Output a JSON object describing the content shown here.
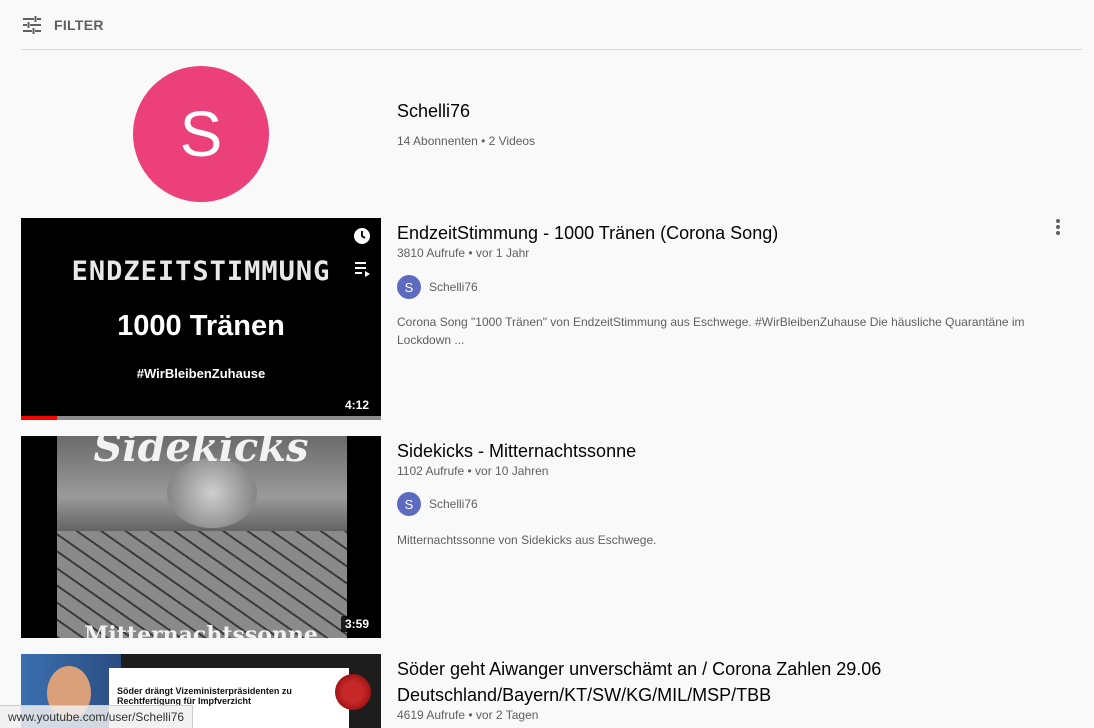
{
  "filter": {
    "label": "FILTER",
    "icon": "filter-sliders-icon"
  },
  "channel": {
    "avatar_letter": "S",
    "avatar_color": "#ec407a",
    "name": "Schelli76",
    "meta": "14 Abonnenten • 2 Videos"
  },
  "videos": [
    {
      "title": "EndzeitStimmung - 1000 Tränen (Corona Song)",
      "meta": "3810 Aufrufe • vor 1 Jahr",
      "channel_avatar": "S",
      "channel_name": "Schelli76",
      "description": "Corona Song \"1000 Tränen\" von EndzeitStimmung aus Eschwege. #WirBleibenZuhause Die häusliche Quarantäne im Lockdown ...",
      "duration": "4:12",
      "watched_fraction": 0.1,
      "thumb_line1": "ENDZEITSTIMMUNG",
      "thumb_line2": "1000 Tränen",
      "thumb_line3": "#WirBleibenZuhause"
    },
    {
      "title": "Sidekicks - Mitternachtssonne",
      "meta": "1102 Aufrufe • vor 10 Jahren",
      "channel_avatar": "S",
      "channel_name": "Schelli76",
      "description": "Mitternachtssonne von Sidekicks aus Eschwege.",
      "duration": "3:59",
      "thumb_top": "Sidekicks",
      "thumb_bottom": "Mitternachtssonne"
    },
    {
      "title": "Söder geht Aiwanger unverschämt an / Corona Zahlen 29.06 Deutschland/Bayern/KT/SW/KG/MIL/MSP/TBB",
      "meta": "4619 Aufrufe • vor 2 Tagen",
      "thumb_headline": "Söder drängt Vizeministerpräsidenten zu Rechtfertigung für Impfverzicht"
    }
  ],
  "status_bar": {
    "url": "www.youtube.com/user/Schelli76"
  },
  "colors": {
    "progress": "#ff0000",
    "channel_avatar_small": "#5c6bc0"
  }
}
